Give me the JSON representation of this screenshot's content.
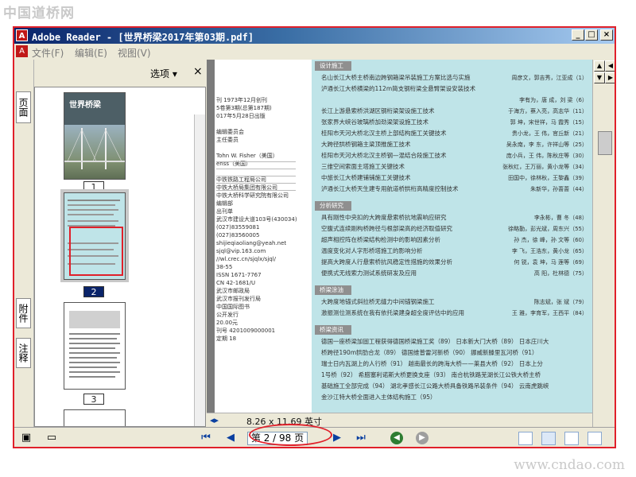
{
  "watermarks": {
    "top": "中国道桥网",
    "bottom": "www.cndao.com"
  },
  "window": {
    "title": "Adobe Reader - [世界桥梁2017年第03期.pdf]"
  },
  "menu": [
    {
      "label": "文件(F)"
    },
    {
      "label": "编辑(E)"
    },
    {
      "label": "视图(V)"
    }
  ],
  "side_tabs": {
    "pages": "页面",
    "attachments": "附件",
    "comments": "注释"
  },
  "panel": {
    "options_label": "选项 ▾",
    "close": "×"
  },
  "thumbnails": [
    {
      "page": "1",
      "cover_title": "世界桥梁"
    },
    {
      "page": "2"
    },
    {
      "page": "3"
    }
  ],
  "left_page": {
    "lines": [
      "刊  1973年12月创刊",
      "5卷第3期(总第187期)",
      "017年5月28日出版",
      "",
      "编辑委员会",
      "主任委员",
      "",
      "Tohn W. Fisher（美国）",
      "enss（美国）",
      "",
      "中铁铁路工程局公司",
      "中铁大桥局集团有限公司",
      "中铁大桥科学研究院有限公司",
      "编辑部",
      "出刊单",
      "武汉市建设大道103号(430034)",
      "(027)83559081",
      "(027)83560005",
      "shijieqiaoliang@yeah.net",
      "sjql@vip.163.com",
      "//wl.crec.cn/sjqlx/sjql/",
      "38-55",
      "ISSN 1671-7767",
      "CN 42-1681/U",
      "武汉市邮政局",
      "武汉市报刊发行局",
      "中国国际图书",
      "公开发行",
      "20.00元",
      "刊号 4201009000001",
      "定期 18"
    ]
  },
  "right_page": {
    "sections": [
      {
        "header": "设计施工",
        "items": [
          {
            "title": "名山长江大桥主桥南边跨钢箱梁吊装施工方案比选与实施",
            "authors": "周彦文，郭吉秀，江亚成（1）"
          },
          {
            "title": "泸通长江大桥横梁的112m简支钢桁梁全悬臂架设安装技术",
            "authors": ""
          },
          {
            "title": "",
            "authors": "李有为，唐 成，刘 梁（6）"
          },
          {
            "title": "长江上游悬索桥洪湖区钢桁梁架设施工技术",
            "authors": "于海方，蔡入亮，高志华（11）"
          },
          {
            "title": "张家界大峡谷玻璃桥加劲梁架设施工技术",
            "authors": "郭 坤，宋世祥，马 霞秀（15）"
          },
          {
            "title": "桂阳市天河大桥北汉主桥上部结构施工关键技术",
            "authors": "贵小龙，王 伟，官丘新（21）"
          },
          {
            "title": "大跨径拱桥钢箱主梁顶推施工技术",
            "authors": "吴永南，李 东，许祥山等（25）"
          },
          {
            "title": "桂阳市天河大桥北汉主桥钢—混结合段施工技术",
            "authors": "庞小兵，王 伟，陈秋庄等（30）"
          },
          {
            "title": "三维空间索面主塔施工关键技术",
            "authors": "张秋红，王万丽，黄小龙等（34）"
          },
          {
            "title": "中旅长江大桥建铺铺施工关键技术",
            "authors": "田国中，徐林秋，王黎鑫（39）"
          },
          {
            "title": "泸通长江大桥天生建专用航道桥拱桁高精度控制技术",
            "authors": "朱新华，孙蔷蔷（44）"
          }
        ]
      },
      {
        "header": "分析研究",
        "items": [
          {
            "title": "具有刚性中央扣的大跨度悬索桥抗地震响应研究",
            "authors": "李永彬，曹 冬（48）"
          },
          {
            "title": "空腹式连续刚构桥跨径与根部梁高的经济取值研究",
            "authors": "徐略勤，彭光斌，周东兴（55）"
          },
          {
            "title": "超声相控阵在桥梁结构检测中的影响因素分析",
            "authors": "孙 杰，徐 峰，孙 文等（60）"
          },
          {
            "title": "温度变化对人字形桥塔施工的影响分析",
            "authors": "李 飞，王浩东，黄小龙（65）"
          },
          {
            "title": "提高大跨度人行悬索桥抗风稳定性措施的效果分析",
            "authors": "何 锐，袁 坤，马 莲等（69）"
          },
          {
            "title": "便携式无线索力测试系统研发及应用",
            "authors": "高 阳，杜林德（75）"
          }
        ]
      },
      {
        "header": "桥梁涂油",
        "items": [
          {
            "title": "大跨度地锚式斜拉桥无缝力中间锚钢梁施工",
            "authors": "陈志斌，张 斌（79）"
          },
          {
            "title": "激振测位测系统在我有依托梁建身超全度评估中的应用",
            "authors": "王 雅，李育军，王西平（84）"
          }
        ]
      },
      {
        "header": "桥梁资讯",
        "items": [
          {
            "title": "德国一座桥梁加固工程获得德国桥梁施工奖（89）  日本新大门大桥（89）  日本庄川大",
            "authors": ""
          },
          {
            "title": "桥跨径190m拱肋合龙（89）  德国维普雷河新桥（90）  挪威新滕里瓦河桥（91）",
            "authors": ""
          },
          {
            "title": "瑞士日内瓦湖上的人行桥（91）  越南最长的跨海大桥——莱县大桥（92）  日本上分",
            "authors": ""
          },
          {
            "title": "1号桥（92）  希腊塞利诺斯大桥更换支座（93）  南合杭铁路芜湖长江公铁大桥主桥",
            "authors": ""
          },
          {
            "title": "基础施工全部完成（94）  湖北孝感长江公路大桥具备铁路吊装条件（94）  云南虎跳峡",
            "authors": ""
          },
          {
            "title": "金沙江特大桥全面进入主体结构施工（95）",
            "authors": ""
          }
        ]
      }
    ]
  },
  "horizontal_bar": {
    "page_size": "8.26 x 11.69 英寸"
  },
  "status": {
    "page_indicator": "第 2 / 98 页"
  },
  "colors": {
    "highlight": "#e0202a",
    "title_bar": "#0a246a",
    "page_tint": "#bfe4e8"
  }
}
